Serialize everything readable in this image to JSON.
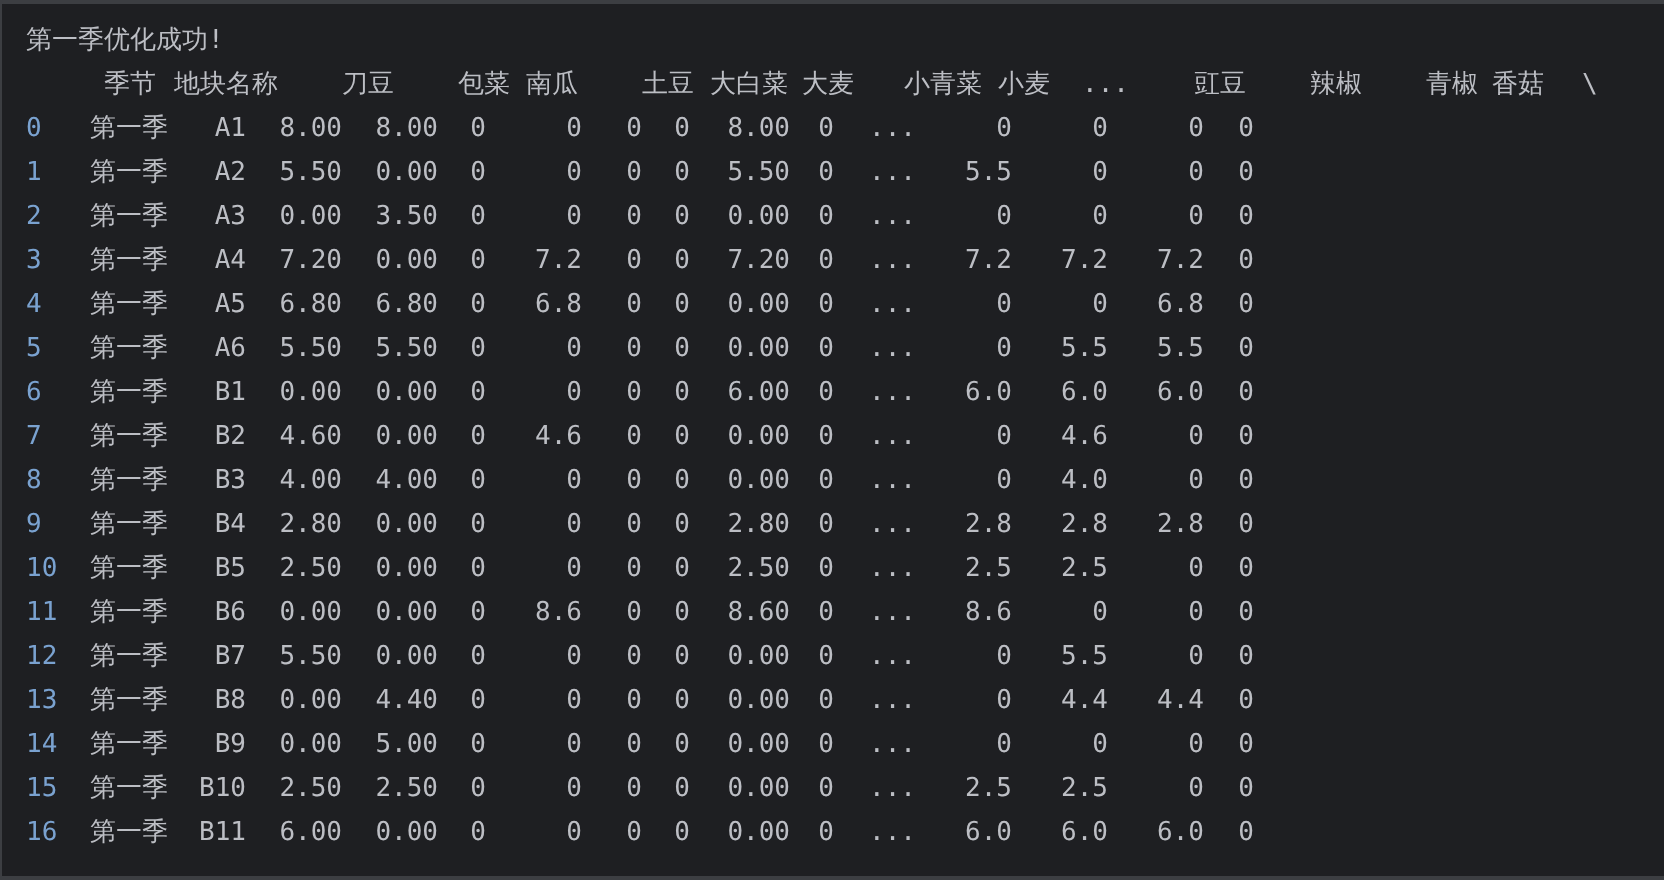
{
  "console": {
    "message": "第一季优化成功!",
    "header_line": [
      "季节",
      "地块名称",
      "刀豆",
      "包菜",
      "南瓜",
      "土豆",
      "大白菜",
      "大麦",
      "小青菜",
      "小麦",
      "...",
      "豇豆",
      "辣椒",
      "青椒",
      "香菇",
      "\\"
    ],
    "rows": [
      {
        "index": "0",
        "cells": [
          "第一季",
          "A1",
          "8.00",
          "8.00",
          "0",
          "0",
          "0",
          "0",
          "8.00",
          "0",
          "...",
          "0",
          "0",
          "0",
          "0"
        ]
      },
      {
        "index": "1",
        "cells": [
          "第一季",
          "A2",
          "5.50",
          "0.00",
          "0",
          "0",
          "0",
          "0",
          "5.50",
          "0",
          "...",
          "5.5",
          "0",
          "0",
          "0"
        ]
      },
      {
        "index": "2",
        "cells": [
          "第一季",
          "A3",
          "0.00",
          "3.50",
          "0",
          "0",
          "0",
          "0",
          "0.00",
          "0",
          "...",
          "0",
          "0",
          "0",
          "0"
        ]
      },
      {
        "index": "3",
        "cells": [
          "第一季",
          "A4",
          "7.20",
          "0.00",
          "0",
          "7.2",
          "0",
          "0",
          "7.20",
          "0",
          "...",
          "7.2",
          "7.2",
          "7.2",
          "0"
        ]
      },
      {
        "index": "4",
        "cells": [
          "第一季",
          "A5",
          "6.80",
          "6.80",
          "0",
          "6.8",
          "0",
          "0",
          "0.00",
          "0",
          "...",
          "0",
          "0",
          "6.8",
          "0"
        ]
      },
      {
        "index": "5",
        "cells": [
          "第一季",
          "A6",
          "5.50",
          "5.50",
          "0",
          "0",
          "0",
          "0",
          "0.00",
          "0",
          "...",
          "0",
          "5.5",
          "5.5",
          "0"
        ]
      },
      {
        "index": "6",
        "cells": [
          "第一季",
          "B1",
          "0.00",
          "0.00",
          "0",
          "0",
          "0",
          "0",
          "6.00",
          "0",
          "...",
          "6.0",
          "6.0",
          "6.0",
          "0"
        ]
      },
      {
        "index": "7",
        "cells": [
          "第一季",
          "B2",
          "4.60",
          "0.00",
          "0",
          "4.6",
          "0",
          "0",
          "0.00",
          "0",
          "...",
          "0",
          "4.6",
          "0",
          "0"
        ]
      },
      {
        "index": "8",
        "cells": [
          "第一季",
          "B3",
          "4.00",
          "4.00",
          "0",
          "0",
          "0",
          "0",
          "0.00",
          "0",
          "...",
          "0",
          "4.0",
          "0",
          "0"
        ]
      },
      {
        "index": "9",
        "cells": [
          "第一季",
          "B4",
          "2.80",
          "0.00",
          "0",
          "0",
          "0",
          "0",
          "2.80",
          "0",
          "...",
          "2.8",
          "2.8",
          "2.8",
          "0"
        ]
      },
      {
        "index": "10",
        "cells": [
          "第一季",
          "B5",
          "2.50",
          "0.00",
          "0",
          "0",
          "0",
          "0",
          "2.50",
          "0",
          "...",
          "2.5",
          "2.5",
          "0",
          "0"
        ]
      },
      {
        "index": "11",
        "cells": [
          "第一季",
          "B6",
          "0.00",
          "0.00",
          "0",
          "8.6",
          "0",
          "0",
          "8.60",
          "0",
          "...",
          "8.6",
          "0",
          "0",
          "0"
        ]
      },
      {
        "index": "12",
        "cells": [
          "第一季",
          "B7",
          "5.50",
          "0.00",
          "0",
          "0",
          "0",
          "0",
          "0.00",
          "0",
          "...",
          "0",
          "5.5",
          "0",
          "0"
        ]
      },
      {
        "index": "13",
        "cells": [
          "第一季",
          "B8",
          "0.00",
          "4.40",
          "0",
          "0",
          "0",
          "0",
          "0.00",
          "0",
          "...",
          "0",
          "4.4",
          "4.4",
          "0"
        ]
      },
      {
        "index": "14",
        "cells": [
          "第一季",
          "B9",
          "0.00",
          "5.00",
          "0",
          "0",
          "0",
          "0",
          "0.00",
          "0",
          "...",
          "0",
          "0",
          "0",
          "0"
        ]
      },
      {
        "index": "15",
        "cells": [
          "第一季",
          "B10",
          "2.50",
          "2.50",
          "0",
          "0",
          "0",
          "0",
          "0.00",
          "0",
          "...",
          "2.5",
          "2.5",
          "0",
          "0"
        ]
      },
      {
        "index": "16",
        "cells": [
          "第一季",
          "B11",
          "6.00",
          "0.00",
          "0",
          "0",
          "0",
          "0",
          "0.00",
          "0",
          "...",
          "6.0",
          "6.0",
          "6.0",
          "0"
        ]
      }
    ]
  }
}
